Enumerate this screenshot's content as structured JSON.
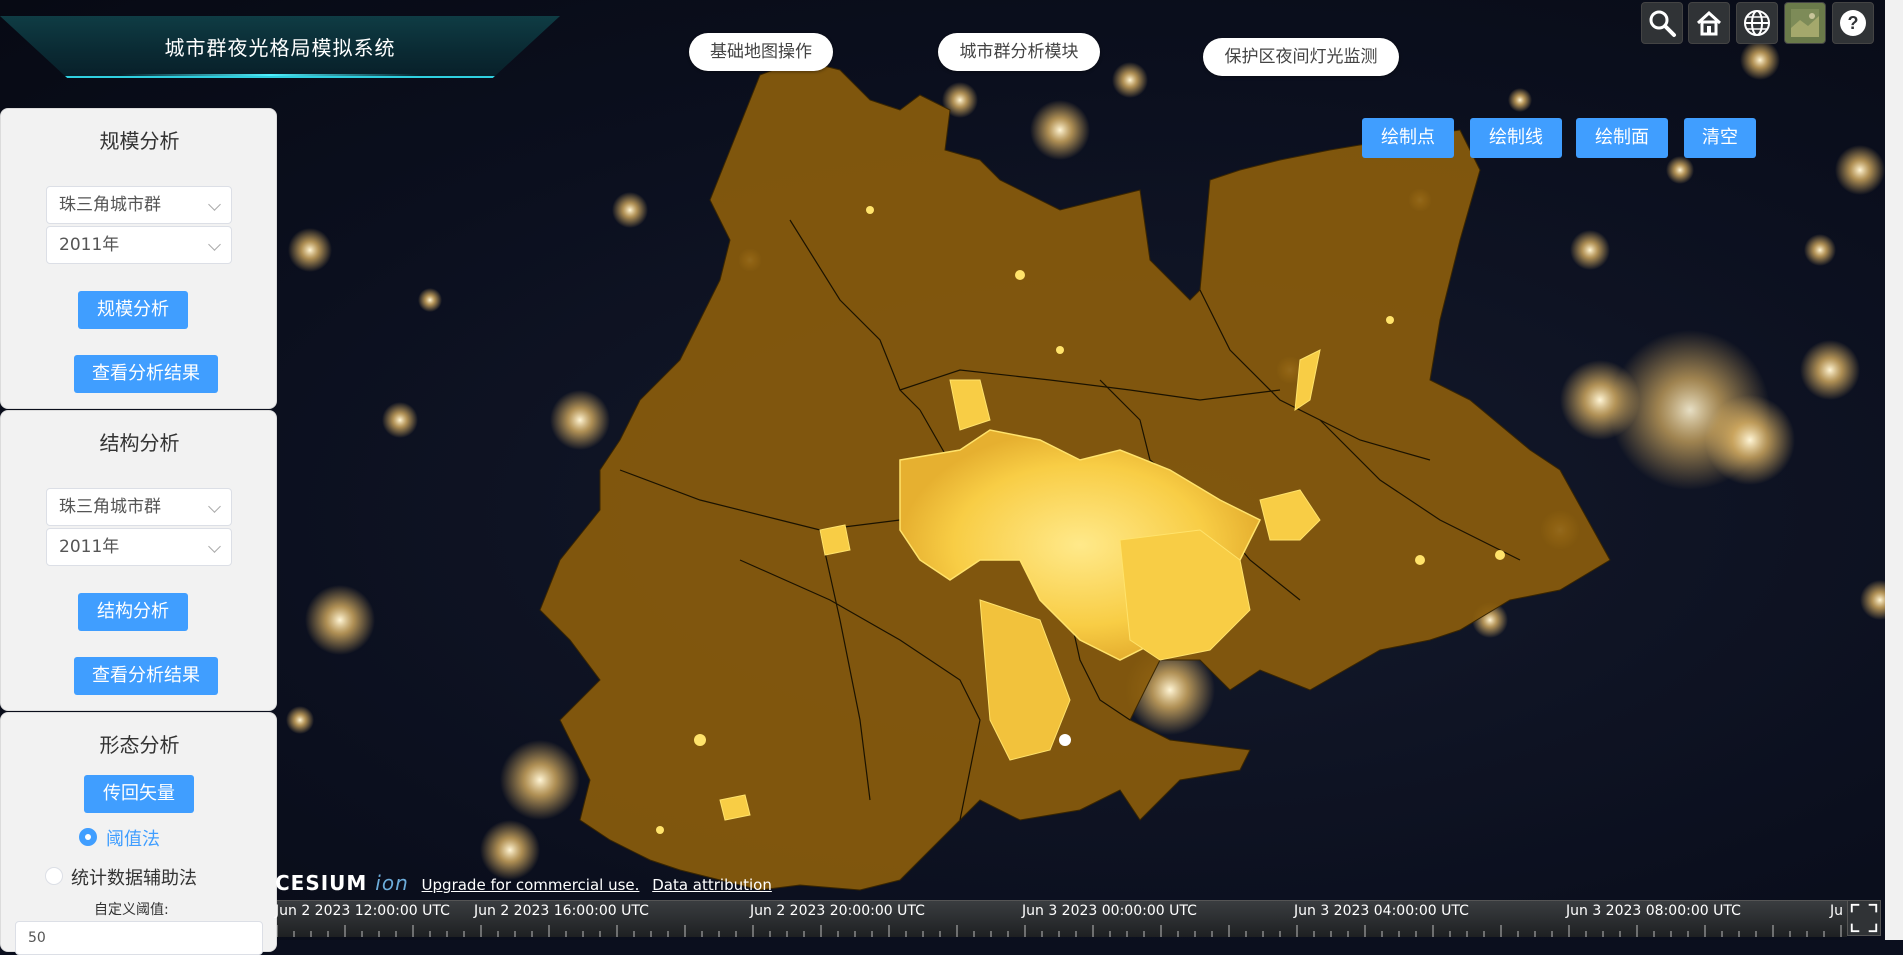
{
  "app": {
    "title": "城市群夜光格局模拟系统"
  },
  "nav": {
    "items": [
      {
        "label": "基础地图操作"
      },
      {
        "label": "城市群分析模块"
      },
      {
        "label": "保护区夜间灯光监测"
      }
    ]
  },
  "toolbar": {
    "icons": [
      "search-icon",
      "home-icon",
      "globe-icon",
      "base-layer-picker-icon",
      "help-icon"
    ],
    "help_label": "?"
  },
  "draw": {
    "point_label": "绘制点",
    "line_label": "绘制线",
    "polygon_label": "绘制面",
    "clear_label": "清空"
  },
  "scale_panel": {
    "title": "规模分析",
    "region_value": "珠三角城市群",
    "year_value": "2011年",
    "analyze_label": "规模分析",
    "result_label": "查看分析结果"
  },
  "structure_panel": {
    "title": "结构分析",
    "region_value": "珠三角城市群",
    "year_value": "2011年",
    "analyze_label": "结构分析",
    "result_label": "查看分析结果"
  },
  "morphology_panel": {
    "title": "形态分析",
    "upload_label": "传回矢量",
    "method_threshold": "阈值法",
    "method_statistics": "统计数据辅助法",
    "threshold_label": "自定义阈值:",
    "threshold_value": "50"
  },
  "credits": {
    "logo": "CESIUM",
    "logo_suffix": "ion",
    "upgrade_link": "Upgrade for commercial use.",
    "attribution_link": "Data attribution"
  },
  "timeline": {
    "labels": [
      "Jun 2 2023 12:00:00 UTC",
      "Jun 2 2023 16:00:00 UTC",
      "Jun 2 2023 20:00:00 UTC",
      "Jun 3 2023 00:00:00 UTC",
      "Jun 3 2023 04:00:00 UTC",
      "Jun 3 2023 08:00:00 UTC",
      "Ju"
    ]
  },
  "colors": {
    "accent": "#409eff",
    "region_fill": "#8a5c0c",
    "urban_core": "#f5c83a",
    "title_glow": "#2fd0e0"
  }
}
